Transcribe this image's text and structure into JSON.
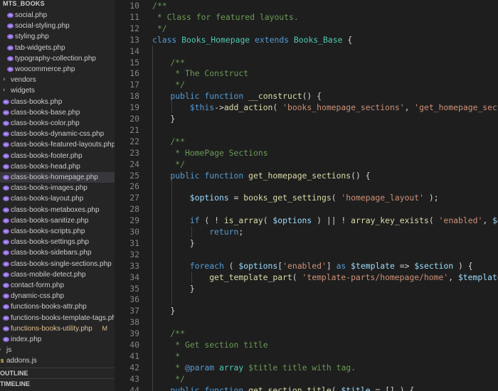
{
  "sidebar": {
    "header": "MTS_BOOKS",
    "items": [
      {
        "label": "social.php",
        "type": "php",
        "depth": 1
      },
      {
        "label": "social-styling.php",
        "type": "php",
        "depth": 1
      },
      {
        "label": "styling.php",
        "type": "php",
        "depth": 1
      },
      {
        "label": "tab-widgets.php",
        "type": "php",
        "depth": 1
      },
      {
        "label": "typography-collection.php",
        "type": "php",
        "depth": 1
      },
      {
        "label": "woocommerce.php",
        "type": "php",
        "depth": 1
      },
      {
        "label": "vendors",
        "type": "folder",
        "depth": 0
      },
      {
        "label": "widgets",
        "type": "folder",
        "depth": 0
      },
      {
        "label": "class-books.php",
        "type": "php",
        "depth": 0
      },
      {
        "label": "class-books-base.php",
        "type": "php",
        "depth": 0
      },
      {
        "label": "class-books-color.php",
        "type": "php",
        "depth": 0
      },
      {
        "label": "class-books-dynamic-css.php",
        "type": "php",
        "depth": 0
      },
      {
        "label": "class-books-featured-layouts.php",
        "type": "php",
        "depth": 0
      },
      {
        "label": "class-books-footer.php",
        "type": "php",
        "depth": 0
      },
      {
        "label": "class-books-head.php",
        "type": "php",
        "depth": 0
      },
      {
        "label": "class-books-homepage.php",
        "type": "php",
        "depth": 0,
        "selected": true
      },
      {
        "label": "class-books-images.php",
        "type": "php",
        "depth": 0
      },
      {
        "label": "class-books-layout.php",
        "type": "php",
        "depth": 0
      },
      {
        "label": "class-books-metaboxes.php",
        "type": "php",
        "depth": 0
      },
      {
        "label": "class-books-sanitize.php",
        "type": "php",
        "depth": 0
      },
      {
        "label": "class-books-scripts.php",
        "type": "php",
        "depth": 0
      },
      {
        "label": "class-books-settings.php",
        "type": "php",
        "depth": 0
      },
      {
        "label": "class-books-sidebars.php",
        "type": "php",
        "depth": 0
      },
      {
        "label": "class-books-single-sections.php",
        "type": "php",
        "depth": 0
      },
      {
        "label": "class-mobile-detect.php",
        "type": "php",
        "depth": 0
      },
      {
        "label": "contact-form.php",
        "type": "php",
        "depth": 0
      },
      {
        "label": "dynamic-css.php",
        "type": "php",
        "depth": 0
      },
      {
        "label": "functions-books-attr.php",
        "type": "php",
        "depth": 0
      },
      {
        "label": "functions-books-template-tags.php",
        "type": "php",
        "depth": 0
      },
      {
        "label": "functions-books-utility.php",
        "type": "php",
        "depth": 0,
        "modified": true,
        "badge": "M"
      },
      {
        "label": "index.php",
        "type": "php",
        "depth": 0
      },
      {
        "label": "js",
        "type": "folder",
        "depth": -1
      },
      {
        "label": "addons.js",
        "type": "js",
        "depth": -1,
        "icon_text": "JS"
      }
    ],
    "panels": [
      {
        "label": "OUTLINE"
      },
      {
        "label": "TIMELINE"
      }
    ]
  },
  "editor": {
    "lines": [
      {
        "n": "10",
        "indent": 0,
        "tokens": [
          [
            "cm",
            "/**"
          ]
        ]
      },
      {
        "n": "11",
        "indent": 0,
        "tokens": [
          [
            "cm",
            " * Class for featured layouts."
          ]
        ]
      },
      {
        "n": "12",
        "indent": 0,
        "tokens": [
          [
            "cm",
            " */"
          ]
        ]
      },
      {
        "n": "13",
        "indent": 0,
        "tokens": [
          [
            "kw",
            "class "
          ],
          [
            "cls",
            "Books_Homepage "
          ],
          [
            "kw",
            "extends "
          ],
          [
            "cls",
            "Books_Base"
          ],
          [
            "tx",
            " {"
          ]
        ]
      },
      {
        "n": "14",
        "indent": 1,
        "tokens": []
      },
      {
        "n": "15",
        "indent": 1,
        "tokens": [
          [
            "cm",
            "/**"
          ]
        ]
      },
      {
        "n": "16",
        "indent": 1,
        "tokens": [
          [
            "cm",
            " * The Construct"
          ]
        ]
      },
      {
        "n": "17",
        "indent": 1,
        "tokens": [
          [
            "cm",
            " */"
          ]
        ]
      },
      {
        "n": "18",
        "indent": 1,
        "tokens": [
          [
            "kw",
            "public function "
          ],
          [
            "fn",
            "__construct"
          ],
          [
            "tx",
            "() {"
          ]
        ]
      },
      {
        "n": "19",
        "indent": 2,
        "tokens": [
          [
            "kw",
            "$this"
          ],
          [
            "tx",
            "->"
          ],
          [
            "fn",
            "add_action"
          ],
          [
            "tx",
            "( "
          ],
          [
            "str",
            "'books_homepage_sections'"
          ],
          [
            "tx",
            ", "
          ],
          [
            "str",
            "'get_homepage_sections'"
          ],
          [
            "tx",
            " "
          ]
        ]
      },
      {
        "n": "20",
        "indent": 1,
        "tokens": [
          [
            "tx",
            "}"
          ]
        ]
      },
      {
        "n": "21",
        "indent": 1,
        "tokens": []
      },
      {
        "n": "22",
        "indent": 1,
        "tokens": [
          [
            "cm",
            "/**"
          ]
        ]
      },
      {
        "n": "23",
        "indent": 1,
        "tokens": [
          [
            "cm",
            " * HomePage Sections"
          ]
        ]
      },
      {
        "n": "24",
        "indent": 1,
        "tokens": [
          [
            "cm",
            " */"
          ]
        ]
      },
      {
        "n": "25",
        "indent": 1,
        "tokens": [
          [
            "kw",
            "public function "
          ],
          [
            "fn",
            "get_homepage_sections"
          ],
          [
            "tx",
            "() {"
          ]
        ]
      },
      {
        "n": "26",
        "indent": 2,
        "tokens": []
      },
      {
        "n": "27",
        "indent": 2,
        "tokens": [
          [
            "vr",
            "$options"
          ],
          [
            "tx",
            " = "
          ],
          [
            "fn",
            "books_get_settings"
          ],
          [
            "tx",
            "( "
          ],
          [
            "str",
            "'homepage_layout'"
          ],
          [
            "tx",
            " );"
          ]
        ]
      },
      {
        "n": "28",
        "indent": 2,
        "tokens": []
      },
      {
        "n": "29",
        "indent": 2,
        "tokens": [
          [
            "kw",
            "if"
          ],
          [
            "tx",
            " ( ! "
          ],
          [
            "fn",
            "is_array"
          ],
          [
            "tx",
            "( "
          ],
          [
            "vr",
            "$options"
          ],
          [
            "tx",
            " ) || ! "
          ],
          [
            "fn",
            "array_key_exists"
          ],
          [
            "tx",
            "( "
          ],
          [
            "str",
            "'enabled'"
          ],
          [
            "tx",
            ", "
          ],
          [
            "vr",
            "$options"
          ]
        ]
      },
      {
        "n": "30",
        "indent": 3,
        "tokens": [
          [
            "kw",
            "return"
          ],
          [
            "tx",
            ";"
          ]
        ]
      },
      {
        "n": "31",
        "indent": 2,
        "tokens": [
          [
            "tx",
            "}"
          ]
        ]
      },
      {
        "n": "32",
        "indent": 2,
        "tokens": []
      },
      {
        "n": "33",
        "indent": 2,
        "tokens": [
          [
            "kw",
            "foreach"
          ],
          [
            "tx",
            " ( "
          ],
          [
            "vr",
            "$options"
          ],
          [
            "tx",
            "["
          ],
          [
            "str",
            "'enabled'"
          ],
          [
            "tx",
            "] "
          ],
          [
            "kw",
            "as "
          ],
          [
            "vr",
            "$template"
          ],
          [
            "tx",
            " => "
          ],
          [
            "vr",
            "$section"
          ],
          [
            "tx",
            " ) {"
          ]
        ]
      },
      {
        "n": "34",
        "indent": 3,
        "tokens": [
          [
            "fn",
            "get_template_part"
          ],
          [
            "tx",
            "( "
          ],
          [
            "str",
            "'template-parts/homepage/home'"
          ],
          [
            "tx",
            ", "
          ],
          [
            "vr",
            "$template"
          ],
          [
            "tx",
            " );"
          ]
        ]
      },
      {
        "n": "35",
        "indent": 2,
        "tokens": [
          [
            "tx",
            "}"
          ]
        ]
      },
      {
        "n": "36",
        "indent": 2,
        "tokens": []
      },
      {
        "n": "37",
        "indent": 1,
        "tokens": [
          [
            "tx",
            "}"
          ]
        ]
      },
      {
        "n": "38",
        "indent": 1,
        "tokens": []
      },
      {
        "n": "39",
        "indent": 1,
        "tokens": [
          [
            "cm",
            "/**"
          ]
        ]
      },
      {
        "n": "40",
        "indent": 1,
        "tokens": [
          [
            "cm",
            " * Get section title"
          ]
        ]
      },
      {
        "n": "41",
        "indent": 1,
        "tokens": [
          [
            "cm",
            " *"
          ]
        ]
      },
      {
        "n": "42",
        "indent": 1,
        "tokens": [
          [
            "cm",
            " * "
          ],
          [
            "kw",
            "@param "
          ],
          [
            "cls",
            "array "
          ],
          [
            "cm",
            "$title title with tag."
          ]
        ]
      },
      {
        "n": "43",
        "indent": 1,
        "tokens": [
          [
            "cm",
            " */"
          ]
        ]
      },
      {
        "n": "44",
        "indent": 1,
        "tokens": [
          [
            "kw",
            "public function "
          ],
          [
            "fn",
            "get_section_title"
          ],
          [
            "tx",
            "( "
          ],
          [
            "vr",
            "$title"
          ],
          [
            "tx",
            " = [] ) {"
          ]
        ]
      }
    ]
  }
}
